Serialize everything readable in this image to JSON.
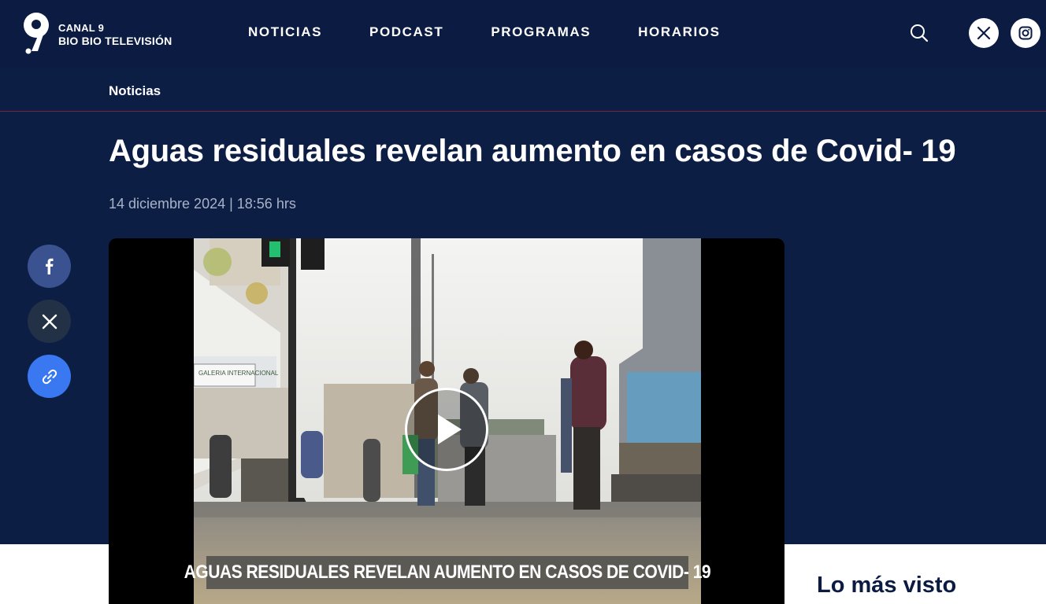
{
  "brand": {
    "line1": "CANAL 9",
    "line2": "BIO BIO TELEVISIÓN",
    "color": "#0b1b42"
  },
  "nav": {
    "items": [
      "NOTICIAS",
      "PODCAST",
      "PROGRAMAS",
      "HORARIOS"
    ]
  },
  "header_icons": [
    "search-icon",
    "x-icon",
    "instagram-icon"
  ],
  "breadcrumb": {
    "label": "Noticias"
  },
  "article": {
    "title": "Aguas residuales revelan aumento en casos de Covid- 19",
    "date": "14 diciembre 2024 | 18:56 hrs"
  },
  "share_icons": [
    "facebook-icon",
    "x-icon",
    "link-icon"
  ],
  "share_colors": {
    "facebook": "#3a5390",
    "x": "#223146",
    "link": "#3a78f2"
  },
  "video": {
    "caption": "AGUAS RESIDUALES REVELAN AUMENTO EN CASOS DE COVID- 19",
    "gallery_sign": "GALERIA INTERNACIONAL"
  },
  "sidebar": {
    "heading": "Lo más visto"
  }
}
